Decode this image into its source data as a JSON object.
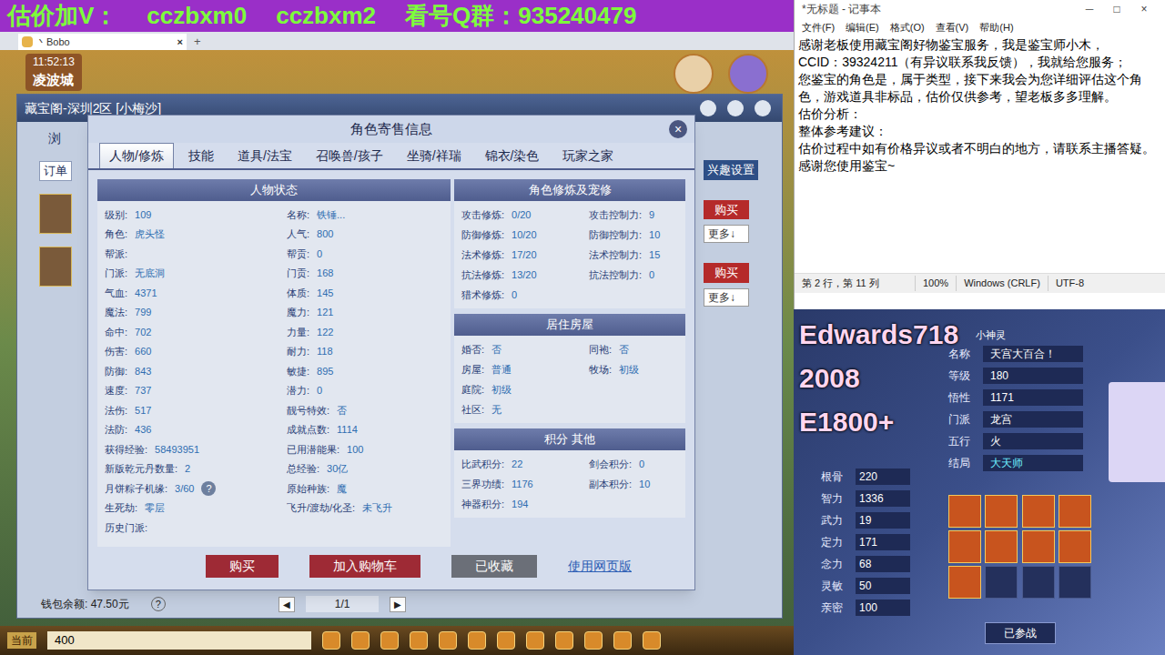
{
  "banner": {
    "parts": [
      "估价加V：",
      "cczbxm0",
      "cczbxm2",
      "看号Q群：935240479"
    ]
  },
  "browser_tab": {
    "title": "丶Bobo",
    "close": "×",
    "new": "+"
  },
  "game_hud": {
    "time": "11:52:13",
    "city": "凌波城"
  },
  "market_window": {
    "title": "藏宝阁-深圳2区 [小梅沙]",
    "browse": "浏",
    "orders": "订单",
    "interest_button": "兴趣设置",
    "rows": [
      {
        "buy": "购买",
        "more": "更多↓"
      },
      {
        "buy": "购买",
        "more": "更多↓"
      }
    ],
    "wallet": "钱包余额: 47.50元",
    "help": "?",
    "pager": {
      "prev": "◀",
      "page": "1/1",
      "next": "▶"
    }
  },
  "dialog": {
    "title": "角色寄售信息",
    "close": "×",
    "tabs": [
      {
        "label": "人物/修炼",
        "selected": true
      },
      {
        "label": "技能",
        "selected": false
      },
      {
        "label": "道具/法宝",
        "selected": false
      },
      {
        "label": "召唤兽/孩子",
        "selected": false
      },
      {
        "label": "坐骑/祥瑞",
        "selected": false
      },
      {
        "label": "锦衣/染色",
        "selected": false
      },
      {
        "label": "玩家之家",
        "selected": false
      }
    ],
    "status_panel": {
      "title": "人物状态",
      "rows": [
        [
          {
            "label": "级别:",
            "value": "109"
          },
          {
            "label": "名称:",
            "value": "铁锤..."
          }
        ],
        [
          {
            "label": "角色:",
            "value": "虎头怪"
          },
          {
            "label": "人气:",
            "value": "800"
          }
        ],
        [
          {
            "label": "帮派:",
            "value": ""
          },
          {
            "label": "帮贡:",
            "value": "0"
          }
        ],
        [
          {
            "label": "门派:",
            "value": "无底洞"
          },
          {
            "label": "门贡:",
            "value": "168"
          }
        ],
        [
          {
            "label": "气血:",
            "value": "4371"
          },
          {
            "label": "体质:",
            "value": "145"
          }
        ],
        [
          {
            "label": "魔法:",
            "value": "799"
          },
          {
            "label": "魔力:",
            "value": "121"
          }
        ],
        [
          {
            "label": "命中:",
            "value": "702"
          },
          {
            "label": "力量:",
            "value": "122"
          }
        ],
        [
          {
            "label": "伤害:",
            "value": "660"
          },
          {
            "label": "耐力:",
            "value": "118"
          }
        ],
        [
          {
            "label": "防御:",
            "value": "843"
          },
          {
            "label": "敏捷:",
            "value": "895"
          }
        ],
        [
          {
            "label": "速度:",
            "value": "737"
          },
          {
            "label": "潜力:",
            "value": "0"
          }
        ],
        [
          {
            "label": "法伤:",
            "value": "517"
          },
          {
            "label": "靓号特效:",
            "value": "否"
          }
        ],
        [
          {
            "label": "法防:",
            "value": "436"
          },
          {
            "label": "成就点数:",
            "value": "1114"
          }
        ],
        [
          {
            "label": "获得经验:",
            "value": "58493951"
          },
          {
            "label": "已用潜能果:",
            "value": "100"
          }
        ],
        [
          {
            "label": "新版乾元丹数量:",
            "value": "2"
          },
          {
            "label": "总经验:",
            "value": "30亿"
          }
        ],
        [
          {
            "label": "月饼粽子机缘:",
            "value": "3/60",
            "help": "?"
          },
          {
            "label": "原始种族:",
            "value": "魔"
          }
        ],
        [
          {
            "label": "生死劫:",
            "value": "零层"
          },
          {
            "label": "飞升/渡劫/化圣:",
            "value": "未飞升"
          }
        ],
        [
          {
            "label": "历史门派:",
            "value": ""
          }
        ]
      ]
    },
    "cultivation_panel": {
      "title": "角色修炼及宠修",
      "rows": [
        [
          {
            "label": "攻击修炼:",
            "value": "0/20"
          },
          {
            "label": "攻击控制力:",
            "value": "9"
          }
        ],
        [
          {
            "label": "防御修炼:",
            "value": "10/20"
          },
          {
            "label": "防御控制力:",
            "value": "10"
          }
        ],
        [
          {
            "label": "法术修炼:",
            "value": "17/20"
          },
          {
            "label": "法术控制力:",
            "value": "15"
          }
        ],
        [
          {
            "label": "抗法修炼:",
            "value": "13/20"
          },
          {
            "label": "抗法控制力:",
            "value": "0"
          }
        ],
        [
          {
            "label": "猎术修炼:",
            "value": "0"
          }
        ]
      ]
    },
    "house_panel": {
      "title": "居住房屋",
      "rows": [
        [
          {
            "label": "婚否:",
            "value": "否"
          },
          {
            "label": "同袍:",
            "value": "否"
          }
        ],
        [
          {
            "label": "房屋:",
            "value": "普通"
          },
          {
            "label": "牧场:",
            "value": "初级"
          }
        ],
        [
          {
            "label": "庭院:",
            "value": "初级"
          }
        ],
        [
          {
            "label": "社区:",
            "value": "无"
          }
        ]
      ]
    },
    "score_panel": {
      "title": "积分 其他",
      "rows": [
        [
          {
            "label": "比武积分:",
            "value": "22"
          },
          {
            "label": "剑会积分:",
            "value": "0"
          }
        ],
        [
          {
            "label": "三界功绩:",
            "value": "1176"
          },
          {
            "label": "副本积分:",
            "value": "10"
          }
        ],
        [
          {
            "label": "神器积分:",
            "value": "194"
          }
        ]
      ]
    },
    "buttons": [
      {
        "label": "购买",
        "kind": "primary"
      },
      {
        "label": "加入购物车",
        "kind": "primary"
      },
      {
        "label": "已收藏",
        "kind": "muted"
      },
      {
        "label": "使用网页版",
        "kind": "link"
      }
    ]
  },
  "bottom_bar": {
    "channel": "当前",
    "value": "400"
  },
  "notepad": {
    "title": "*无标题 - 记事本",
    "controls": [
      "─",
      "□",
      "×"
    ],
    "menu": [
      "文件(F)",
      "编辑(E)",
      "格式(O)",
      "查看(V)",
      "帮助(H)"
    ],
    "lines": [
      "感谢老板使用藏宝阁好物鉴宝服务，我是鉴宝师小木，",
      "CCID：39324211（有异议联系我反馈），我就给您服务；",
      "您鉴宝的角色是，属于类型，接下来我会为您详细评估这个角色，游戏道具非标品，估价仅供参考，望老板多多理解。",
      "估价分析：",
      "整体参考建议：",
      "估价过程中如有价格异议或者不明白的地方，请联系主播答疑。感谢您使用鉴宝~"
    ],
    "status": [
      "第 2 行，第 11 列",
      "100%",
      "Windows (CRLF)",
      "UTF-8"
    ]
  },
  "stream_panel": {
    "overlay": [
      "Edwards718",
      "2008",
      "E1800+"
    ],
    "pet_title": "小神灵",
    "info": [
      {
        "label": "名称",
        "value": "天宫大百合！"
      },
      {
        "label": "等级",
        "value": "180"
      },
      {
        "label": "悟性",
        "value": "1171"
      },
      {
        "label": "门派",
        "value": "龙宫"
      },
      {
        "label": "五行",
        "value": "火"
      },
      {
        "label": "结局",
        "value": "大天师"
      }
    ],
    "stats": [
      {
        "label": "根骨",
        "value": "220"
      },
      {
        "label": "智力",
        "value": "1336"
      },
      {
        "label": "武力",
        "value": "19"
      },
      {
        "label": "定力",
        "value": "171"
      },
      {
        "label": "念力",
        "value": "68"
      },
      {
        "label": "灵敏",
        "value": "50"
      },
      {
        "label": "亲密",
        "value": "100"
      }
    ],
    "skills": [
      {
        "filled": true
      },
      {
        "filled": true
      },
      {
        "filled": true
      },
      {
        "filled": true
      },
      {
        "filled": true
      },
      {
        "filled": true
      },
      {
        "filled": true
      },
      {
        "filled": true
      },
      {
        "filled": true
      },
      {
        "filled": false
      },
      {
        "filled": false
      },
      {
        "filled": false
      }
    ],
    "battle_button": "已参战"
  }
}
